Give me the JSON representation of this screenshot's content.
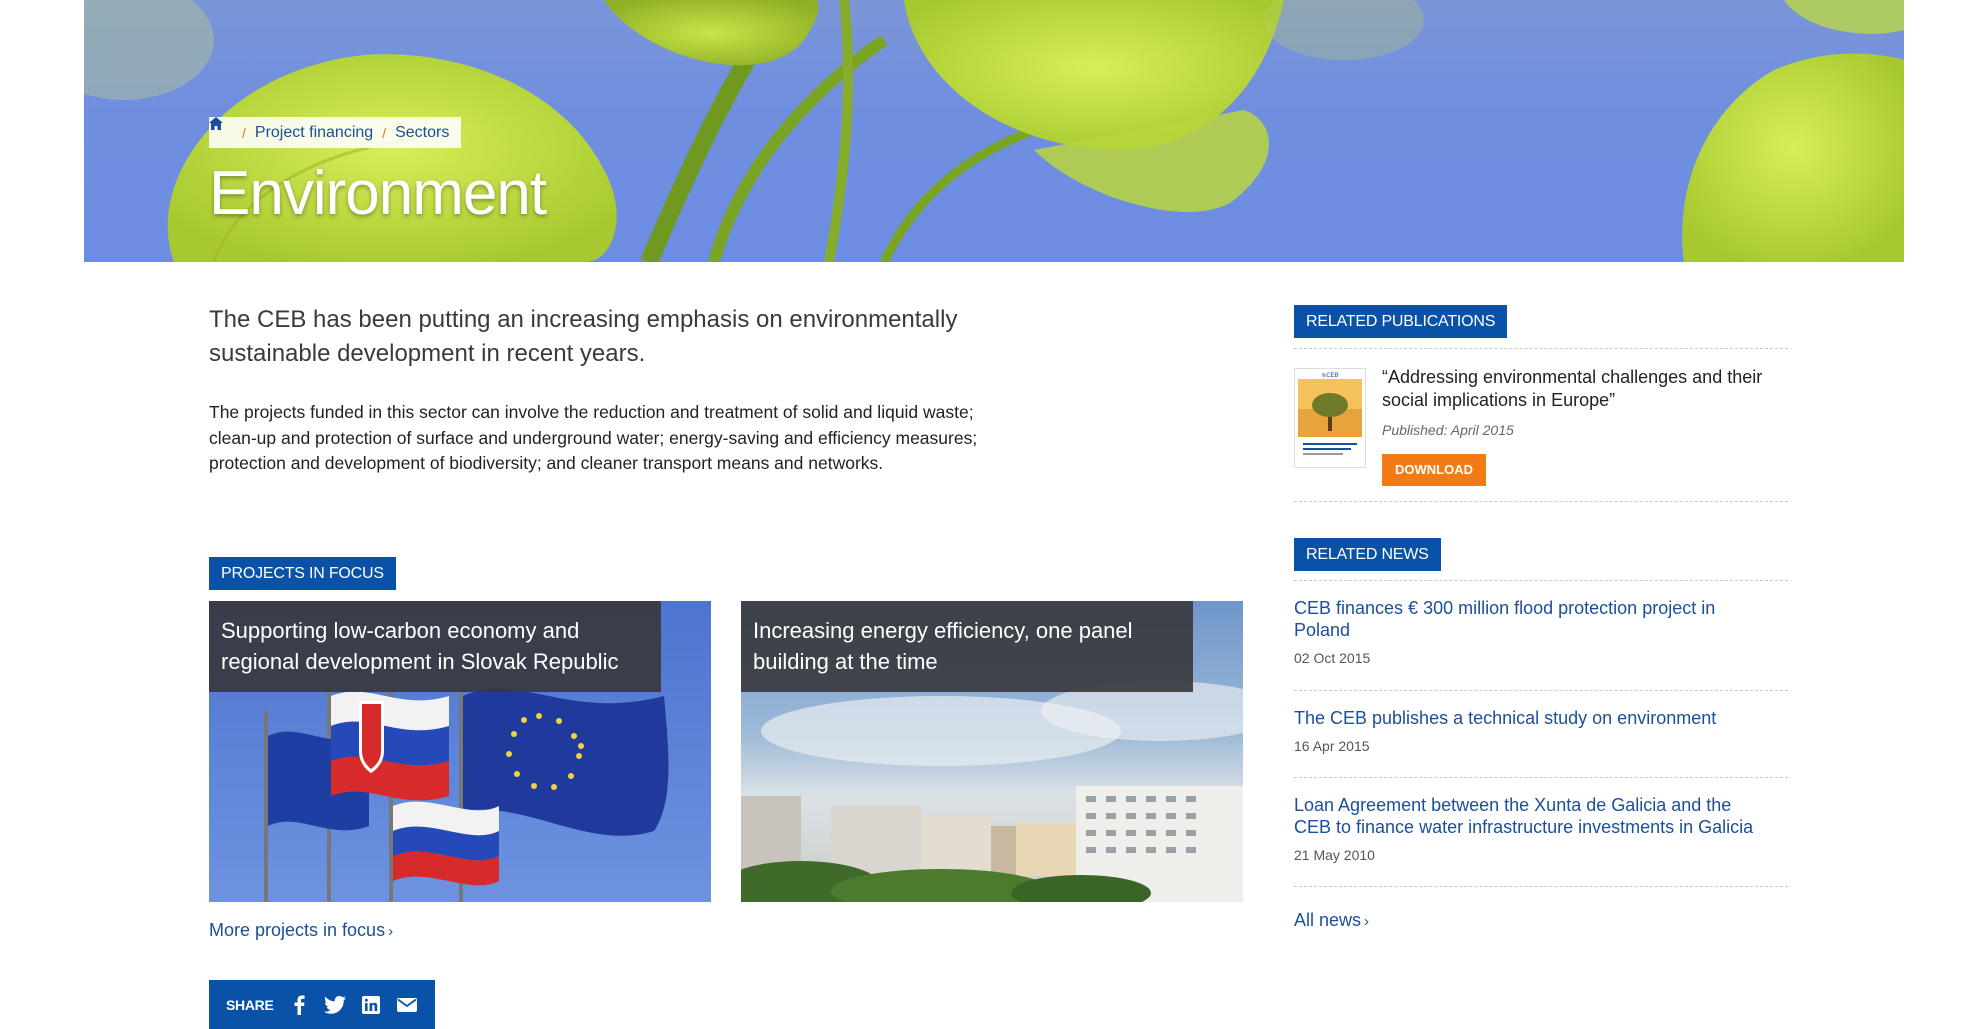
{
  "breadcrumb": {
    "items": [
      "Project financing",
      "Sectors"
    ]
  },
  "hero": {
    "title": "Environment"
  },
  "intro": {
    "lead": "The CEB has been putting an increasing emphasis on environmentally sustainable development in recent years.",
    "body": "The projects funded in this sector can involve the reduction and treatment of solid and liquid waste; clean-up and protection of surface and underground water; energy-saving and efficiency measures; protection and development of biodiversity; and cleaner transport means and networks."
  },
  "projects": {
    "heading": "PROJECTS IN FOCUS",
    "cards": [
      {
        "caption": "Supporting low-carbon economy and regional development in Slovak Republic"
      },
      {
        "caption": "Increasing energy efficiency, one panel building at the time"
      }
    ],
    "more_label": "More projects in focus"
  },
  "share": {
    "label": "SHARE",
    "icons": [
      "facebook-icon",
      "twitter-icon",
      "linkedin-icon",
      "email-icon"
    ]
  },
  "publications": {
    "heading": "RELATED PUBLICATIONS",
    "item": {
      "title": "“Addressing environmental challenges and their social implications in Europe”",
      "published": "Published: April 2015",
      "download_label": "DOWNLOAD"
    }
  },
  "news": {
    "heading": "RELATED NEWS",
    "items": [
      {
        "title": "CEB finances € 300 million flood protection project in Poland",
        "date": "02 Oct 2015"
      },
      {
        "title": "The CEB publishes a technical study on environment",
        "date": "16 Apr 2015"
      },
      {
        "title": "Loan Agreement between the Xunta de Galicia and the CEB to finance water infrastructure investments in Galicia",
        "date": "21 May 2010"
      }
    ],
    "all_label": "All news"
  },
  "colors": {
    "brand_blue": "#0a52a8",
    "link_blue": "#1b4f99",
    "download_orange": "#f47a13",
    "breadcrumb_separator": "#e07a1a"
  }
}
